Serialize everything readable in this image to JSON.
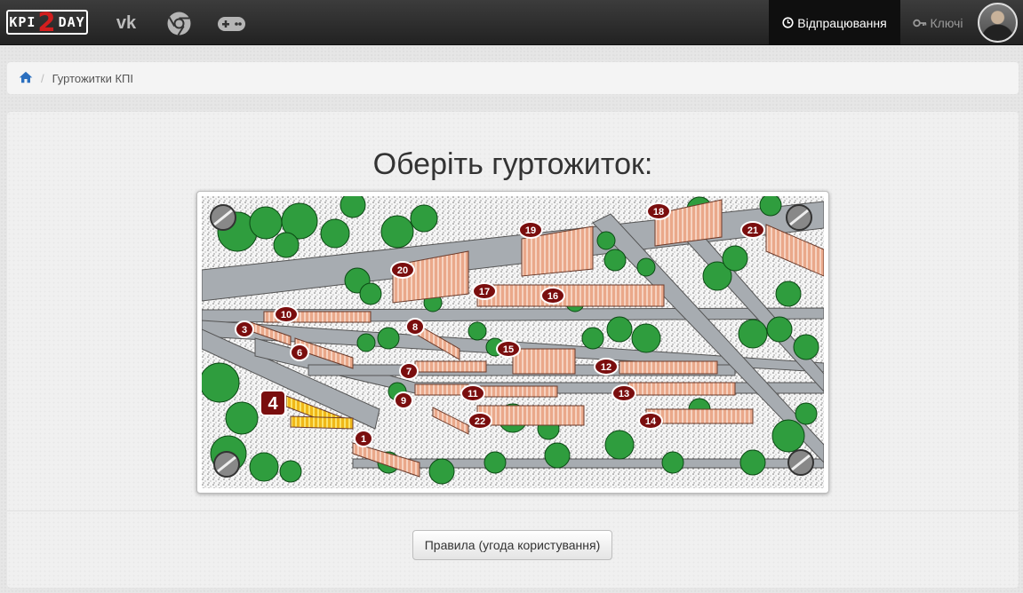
{
  "navbar": {
    "logo": {
      "left": "KPI",
      "num": "2",
      "right": "DAY"
    },
    "icons": [
      "vk-icon",
      "chrome-icon",
      "gamepad-icon"
    ],
    "active_item": {
      "icon": "clock-icon",
      "label": "Відпрацювання"
    },
    "keys_item": {
      "icon": "key-icon",
      "label": "Ключі"
    }
  },
  "breadcrumb": {
    "home_icon": "home-icon",
    "current": "Гуртожитки КПІ"
  },
  "main": {
    "title": "Оберіть гуртожиток:",
    "map": {
      "dorm_pins": [
        "1",
        "3",
        "4",
        "6",
        "7",
        "8",
        "9",
        "10",
        "11",
        "12",
        "13",
        "14",
        "15",
        "16",
        "17",
        "18",
        "19",
        "20",
        "21",
        "22"
      ],
      "highlighted_dorm": "4"
    },
    "rules_button": "Правила (угода користування)"
  },
  "colors": {
    "navbar": "#2b2b2b",
    "pin": "#7a0e0e",
    "building": "#e9a98c",
    "highlighted_building": "#f2c21b",
    "trees": "#2f9d3e",
    "road": "#9aa0a6"
  }
}
